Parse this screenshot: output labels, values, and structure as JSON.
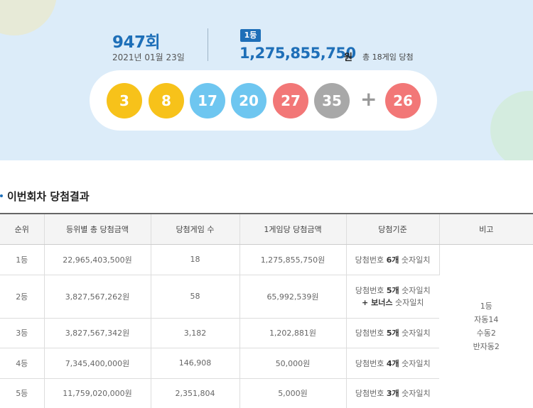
{
  "draw": {
    "round": "947회",
    "date": "2021년 01월 23일",
    "rank_badge": "1등",
    "first_prize_amount": "1,275,855,750",
    "first_prize_unit": "원",
    "first_prize_winners": "총 18게임 당첨",
    "plus_sign": "+",
    "numbers": [
      {
        "value": "3",
        "color": "#f7c21a"
      },
      {
        "value": "8",
        "color": "#f7c21a"
      },
      {
        "value": "17",
        "color": "#6ec6f0"
      },
      {
        "value": "20",
        "color": "#6ec6f0"
      },
      {
        "value": "27",
        "color": "#f27777"
      },
      {
        "value": "35",
        "color": "#a8a8a8"
      }
    ],
    "bonus": {
      "value": "26",
      "color": "#f27777"
    }
  },
  "section_title": "이번회차 당첨결과",
  "table": {
    "headers": [
      "순위",
      "등위별 총 당첨금액",
      "당첨게임 수",
      "1게임당 당첨금액",
      "당첨기준",
      "비고"
    ],
    "rows": [
      {
        "rank": "1등",
        "total": "22,965,403,500원",
        "games": "18",
        "per_game": "1,275,855,750원",
        "criteria": {
          "pre": "당첨번호 ",
          "bold": "6개",
          "post": " 숫자일치"
        }
      },
      {
        "rank": "2등",
        "total": "3,827,567,262원",
        "games": "58",
        "per_game": "65,992,539원",
        "criteria": {
          "pre": "당첨번호 ",
          "bold": "5개",
          "post": " 숫자일치",
          "line2_bold": "+ 보너스",
          "line2_post": " 숫자일치"
        }
      },
      {
        "rank": "3등",
        "total": "3,827,567,342원",
        "games": "3,182",
        "per_game": "1,202,881원",
        "criteria": {
          "pre": "당첨번호 ",
          "bold": "5개",
          "post": " 숫자일치"
        }
      },
      {
        "rank": "4등",
        "total": "7,345,400,000원",
        "games": "146,908",
        "per_game": "50,000원",
        "criteria": {
          "pre": "당첨번호 ",
          "bold": "4개",
          "post": " 숫자일치"
        }
      },
      {
        "rank": "5등",
        "total": "11,759,020,000원",
        "games": "2,351,804",
        "per_game": "5,000원",
        "criteria": {
          "pre": "당첨번호 ",
          "bold": "3개",
          "post": " 숫자일치"
        }
      }
    ],
    "note": [
      "1등",
      "자동14",
      "수동2",
      "반자동2"
    ]
  }
}
